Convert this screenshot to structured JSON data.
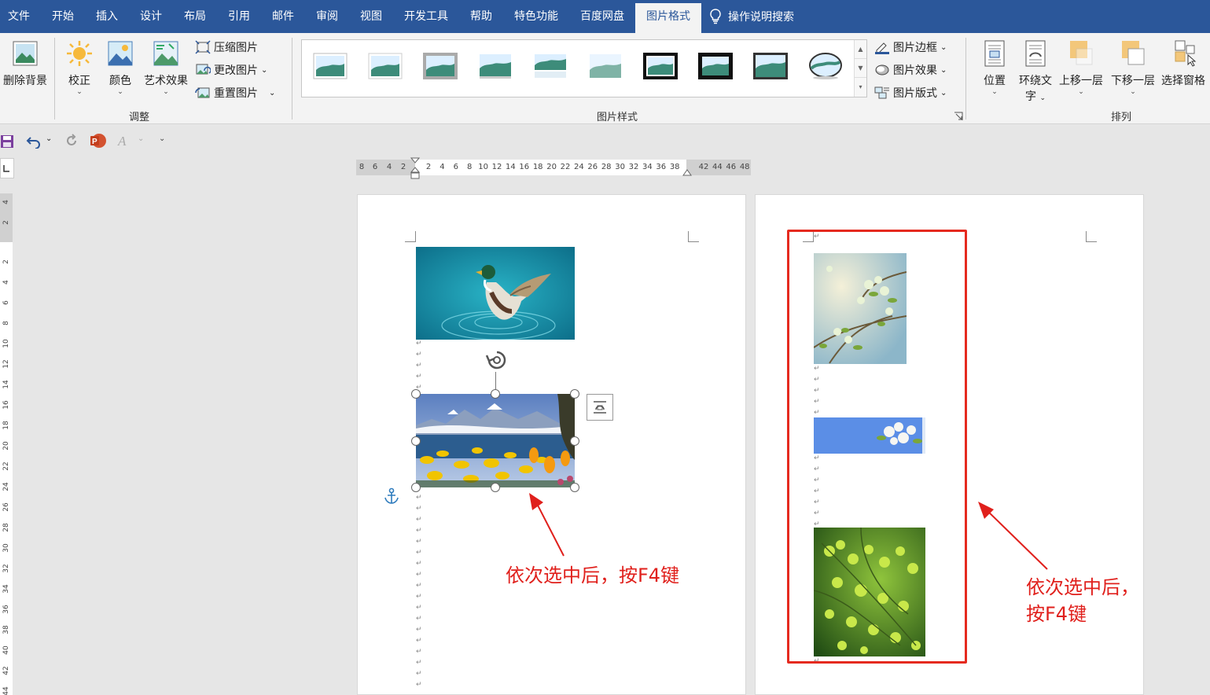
{
  "menubar": {
    "items": [
      "文件",
      "开始",
      "插入",
      "设计",
      "布局",
      "引用",
      "邮件",
      "审阅",
      "视图",
      "开发工具",
      "帮助",
      "特色功能",
      "百度网盘",
      "图片格式"
    ],
    "active": "图片格式",
    "tell_me": "操作说明搜索"
  },
  "ribbon": {
    "remove_bg": "删除背景",
    "corrections": "校正",
    "color": "颜色",
    "artistic": "艺术效果",
    "compress": "压缩图片",
    "change": "更改图片",
    "reset": "重置图片",
    "group_adjust": "调整",
    "group_styles": "图片样式",
    "border": "图片边框",
    "effects": "图片效果",
    "layout": "图片版式",
    "position": "位置",
    "wrap_line1": "环绕文",
    "wrap_line2": "字",
    "bring_forward": "上移一层",
    "send_backward": "下移一层",
    "selection_pane": "选择窗格",
    "group_arrange": "排列"
  },
  "ruler": {
    "left_ticks": [
      "8",
      "6",
      "4",
      "2"
    ],
    "right_ticks": [
      "2",
      "4",
      "6",
      "8",
      "10",
      "12",
      "14",
      "16",
      "18",
      "20",
      "22",
      "24",
      "26",
      "28",
      "30",
      "32",
      "34",
      "36",
      "38",
      "42",
      "44",
      "46",
      "48"
    ],
    "vertical_ticks": [
      "4",
      "2",
      "2",
      "4",
      "6",
      "8",
      "10",
      "12",
      "14",
      "16",
      "18",
      "20",
      "22",
      "24",
      "26",
      "28",
      "30",
      "32",
      "34",
      "36",
      "38",
      "40",
      "42",
      "44"
    ]
  },
  "annotations": {
    "left": "依次选中后，按F4键",
    "right_line1": "依次选中后，",
    "right_line2": "按F4键"
  },
  "colors": {
    "menubar": "#2b579a",
    "annotation": "#e0201c",
    "ribbon": "#f3f3f3"
  }
}
